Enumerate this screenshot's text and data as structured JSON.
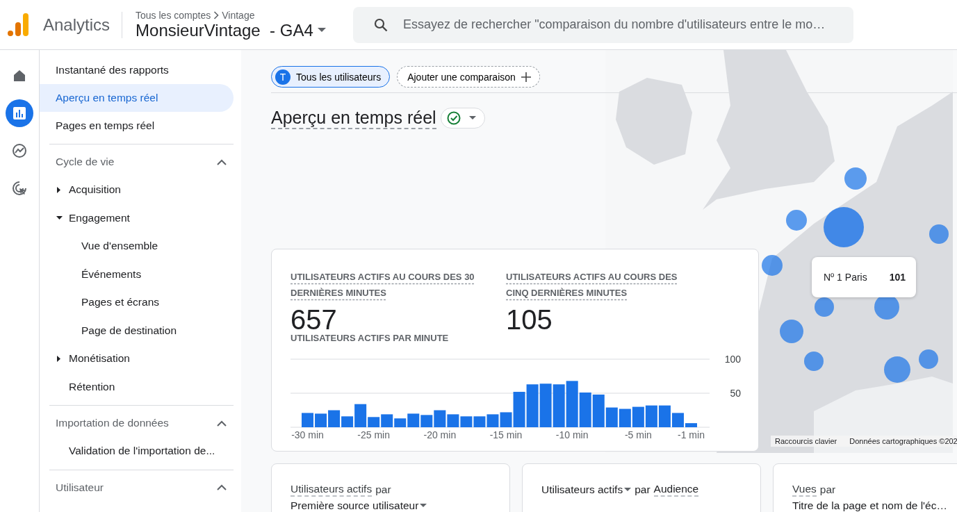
{
  "header": {
    "product": "Analytics",
    "breadcrumb": [
      "Tous les comptes",
      "Vintage"
    ],
    "property": "MonsieurVintage  - GA4",
    "search": {
      "placeholder": "Essayez de rechercher \"comparaison du nombre d'utilisateurs entre le mo…"
    }
  },
  "rail": [
    {
      "kind": "home",
      "selected": false
    },
    {
      "kind": "reports",
      "selected": true
    },
    {
      "kind": "explore",
      "selected": false
    },
    {
      "kind": "advertising",
      "selected": false
    }
  ],
  "nav": [
    {
      "kind": "link",
      "label": "Instantané des rapports",
      "selected": false
    },
    {
      "kind": "link",
      "label": "Aperçu en temps réel",
      "selected": true
    },
    {
      "kind": "link",
      "label": "Pages en temps réel",
      "selected": false
    },
    {
      "kind": "section",
      "label": "Cycle de vie",
      "expanded": true,
      "children": [
        {
          "label": "Acquisition",
          "expanded": false
        },
        {
          "label": "Engagement",
          "expanded": true,
          "children": [
            {
              "label": "Vue d'ensemble"
            },
            {
              "label": "Événements"
            },
            {
              "label": "Pages et écrans"
            },
            {
              "label": "Page de destination"
            }
          ]
        },
        {
          "label": "Monétisation",
          "expanded": false
        },
        {
          "label": "Rétention"
        }
      ]
    },
    {
      "kind": "section",
      "label": "Importation de données",
      "expanded": true,
      "children": [
        {
          "label": "Validation de l'importation de..."
        }
      ]
    },
    {
      "kind": "section",
      "label": "Utilisateur",
      "expanded": true
    }
  ],
  "comparisons": [
    {
      "kind": "segment",
      "initial": "T",
      "label": "Tous les utilisateurs"
    },
    {
      "kind": "add",
      "label": "Ajouter une comparaison"
    }
  ],
  "page_title": "Aperçu en temps réel",
  "metrics": [
    {
      "label": "UTILISATEURS ACTIFS AU COURS DES 30 DERNIÈRES MINUTES",
      "value": "657"
    },
    {
      "label": "UTILISATEURS ACTIFS AU COURS DES CINQ DERNIÈRES MINUTES",
      "value": "105"
    }
  ],
  "chart_data": {
    "type": "bar",
    "title": "UTILISATEURS ACTIFS PAR MINUTE",
    "x": [
      -30,
      -29,
      -28,
      -27,
      -26,
      -25,
      -24,
      -23,
      -22,
      -21,
      -20,
      -19,
      -18,
      -17,
      -16,
      -15,
      -14,
      -13,
      -12,
      -11,
      -10,
      -9,
      -8,
      -7,
      -6,
      -5,
      -4,
      -3,
      -2,
      -1
    ],
    "series": [
      {
        "color": "#1a73e8",
        "values": [
          21,
          20,
          25,
          16,
          34,
          15,
          19,
          13,
          20,
          18,
          25,
          19,
          16,
          16,
          19,
          22,
          52,
          63,
          64,
          63,
          68,
          51,
          48,
          29,
          27,
          30,
          32,
          32,
          21,
          6
        ]
      }
    ],
    "xlim": [
      -30.5,
      -0.5
    ],
    "ylim": [
      0,
      100
    ],
    "yticks": [
      50,
      100
    ],
    "xticks": [
      {
        "value": -30,
        "label": "-30 min"
      },
      {
        "value": -25,
        "label": "-25 min"
      },
      {
        "value": -20,
        "label": "-20 min"
      },
      {
        "value": -15,
        "label": "-15 min"
      },
      {
        "value": -10,
        "label": "-10 min"
      },
      {
        "value": -5,
        "label": "-5 min"
      },
      {
        "value": -1,
        "label": "-1 min"
      }
    ]
  },
  "map": {
    "kind": "picture",
    "tooltip": {
      "label": "Nº 1 Paris",
      "value": "101"
    },
    "attribution": [
      "Raccourcis clavier",
      "Données cartographiques ©202"
    ]
  },
  "cards": [
    {
      "kind": "two_line",
      "metric": "Utilisateurs actifs",
      "metric_dropdown": false,
      "connector": "par",
      "dimension": "Première source utilisateur",
      "dimension_dropdown": true
    },
    {
      "kind": "one_line",
      "metric": "Utilisateurs actifs",
      "metric_dropdown": true,
      "connector": "par",
      "dimension": "Audience",
      "dimension_dropdown": false
    },
    {
      "kind": "two_line",
      "metric": "Vues",
      "metric_dropdown": false,
      "connector": "par",
      "dimension": "Titre de la page et nom de l'éc…",
      "dimension_dropdown": false
    }
  ]
}
